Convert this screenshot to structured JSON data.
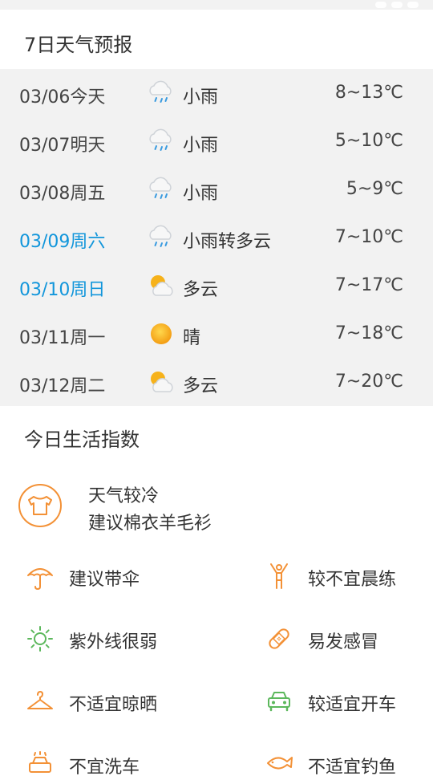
{
  "forecast": {
    "title": "7日天气预报",
    "days": [
      {
        "date": "03/06今天",
        "icon": "light-rain-icon",
        "condition": "小雨",
        "temp": "8~13℃",
        "highlight": false
      },
      {
        "date": "03/07明天",
        "icon": "light-rain-icon",
        "condition": "小雨",
        "temp": "5~10℃",
        "highlight": false
      },
      {
        "date": "03/08周五",
        "icon": "light-rain-icon",
        "condition": "小雨",
        "temp": "5~9℃",
        "highlight": false
      },
      {
        "date": "03/09周六",
        "icon": "light-rain-icon",
        "condition": "小雨转多云",
        "temp": "7~10℃",
        "highlight": true
      },
      {
        "date": "03/10周日",
        "icon": "partly-cloudy-icon",
        "condition": "多云",
        "temp": "7~17℃",
        "highlight": true
      },
      {
        "date": "03/11周一",
        "icon": "sunny-icon",
        "condition": "晴",
        "temp": "7~18℃",
        "highlight": false
      },
      {
        "date": "03/12周二",
        "icon": "partly-cloudy-icon",
        "condition": "多云",
        "temp": "7~20℃",
        "highlight": false
      }
    ]
  },
  "life": {
    "title": "今日生活指数",
    "featured": {
      "icon": "clothing-icon",
      "line1": "天气较冷",
      "line2": "建议棉衣羊毛衫"
    },
    "items": [
      {
        "icon": "umbrella-icon",
        "label": "建议带伞"
      },
      {
        "icon": "exercise-icon",
        "label": "较不宜晨练"
      },
      {
        "icon": "uv-sun-icon",
        "label": "紫外线很弱"
      },
      {
        "icon": "bandage-icon",
        "label": "易发感冒"
      },
      {
        "icon": "hanger-icon",
        "label": "不适宜晾晒"
      },
      {
        "icon": "car-icon",
        "label": "较适宜开车"
      },
      {
        "icon": "car-wash-icon",
        "label": "不宜洗车"
      },
      {
        "icon": "fishing-icon",
        "label": "不适宜钓鱼"
      }
    ]
  },
  "colors": {
    "accent_orange": "#f39136",
    "accent_green": "#5cb85c",
    "highlight_blue": "#1296db",
    "panel_gray": "#f2f2f2"
  }
}
